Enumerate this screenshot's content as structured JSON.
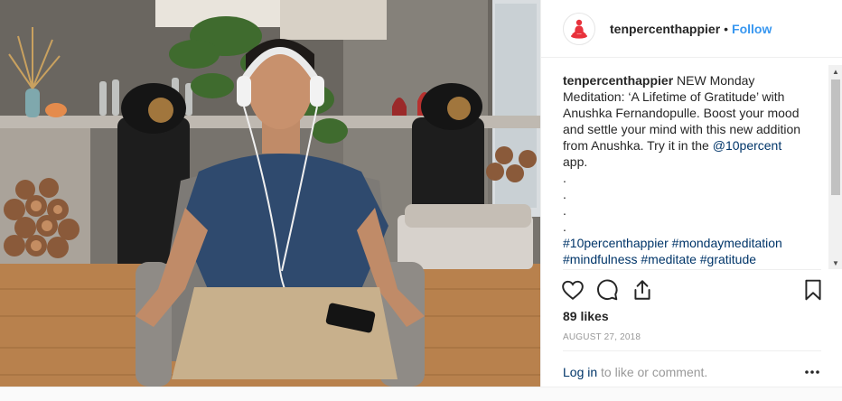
{
  "header": {
    "username": "tenpercenthappier",
    "separator": "•",
    "follow_label": "Follow"
  },
  "caption": {
    "username": "tenpercenthappier",
    "text_1": "NEW Monday Meditation: ‘A Lifetime of Gratitude’ with Anushka Fernandopulle. Boost your mood and settle your mind with this new addition from Anushka. Try it in the",
    "mention": "@10percent",
    "text_2": "app.",
    "dots": [
      ".",
      ".",
      ".",
      "."
    ],
    "hashtags_1": [
      "#10percenthappier",
      "#mondaymeditation"
    ],
    "hashtags_2": [
      "#mindfulness",
      "#meditate",
      "#gratitude"
    ]
  },
  "actions": {
    "like_icon": "heart-icon",
    "comment_icon": "comment-icon",
    "share_icon": "share-icon",
    "save_icon": "bookmark-icon"
  },
  "likes": "89 likes",
  "date": "AUGUST 27, 2018",
  "login": {
    "link": "Log in",
    "rest": "to like or comment."
  },
  "more_icon": "more-options-icon",
  "colors": {
    "brand_red": "#e8323c",
    "link_blue": "#3897f0",
    "dark_link": "#003569",
    "muted": "#999999"
  }
}
